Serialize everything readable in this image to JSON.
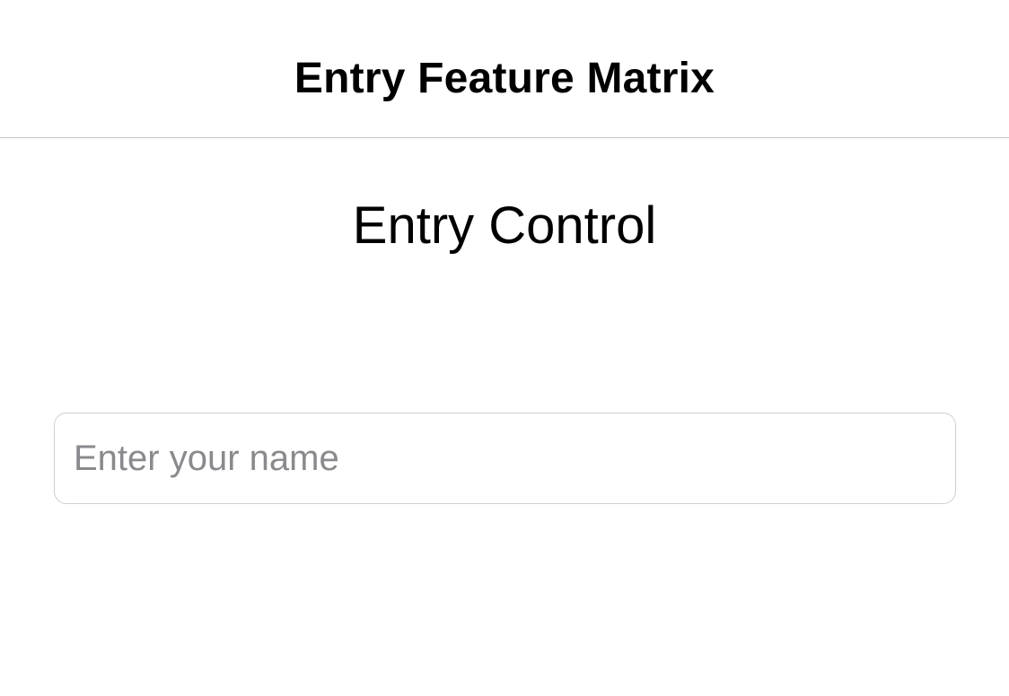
{
  "nav": {
    "title": "Entry Feature Matrix"
  },
  "main": {
    "heading": "Entry Control",
    "name_input": {
      "value": "",
      "placeholder": "Enter your name"
    }
  },
  "colors": {
    "background": "#ffffff",
    "divider": "#c6c6c8",
    "field_border": "#cfcfcf",
    "placeholder": "#8a8a8e",
    "text": "#000000"
  }
}
